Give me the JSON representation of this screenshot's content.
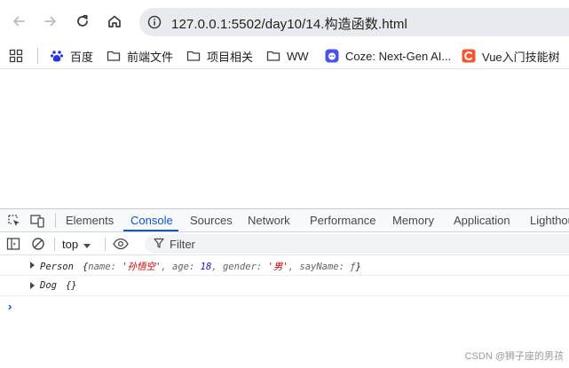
{
  "browser": {
    "url": "127.0.0.1:5502/day10/14.构造函数.html",
    "nav_icons": [
      "back-arrow-icon",
      "forward-arrow-icon",
      "reload-icon",
      "home-icon",
      "site-info-icon"
    ]
  },
  "bookmarks": {
    "items": [
      {
        "label": "百度",
        "icon": "baidu-paw-icon"
      },
      {
        "label": "前端文件",
        "icon": "folder-icon"
      },
      {
        "label": "项目相关",
        "icon": "folder-icon"
      },
      {
        "label": "WW",
        "icon": "folder-icon"
      },
      {
        "label": "Coze: Next-Gen AI...",
        "icon": "coze-icon"
      },
      {
        "label": "Vue入门技能树",
        "icon": "csdn-icon"
      }
    ]
  },
  "devtools": {
    "tabs": [
      "Elements",
      "Console",
      "Sources",
      "Network",
      "Performance",
      "Memory",
      "Application",
      "Lighthouse"
    ],
    "active_tab": "Console",
    "context": "top",
    "filter_placeholder": "Filter",
    "logs": [
      {
        "class_name": "Person",
        "open": "{",
        "props": [
          {
            "key": "name",
            "value": "'孙悟空'",
            "type": "string"
          },
          {
            "key": "age",
            "value": "18",
            "type": "number"
          },
          {
            "key": "gender",
            "value": "'男'",
            "type": "string"
          },
          {
            "key": "sayName",
            "value": "ƒ",
            "type": "function"
          }
        ],
        "close": "}"
      },
      {
        "class_name": "Dog",
        "open": "{",
        "props": [],
        "close": "}"
      }
    ],
    "prompt": "›"
  },
  "watermark": "CSDN @狮子座的男孩",
  "colors": {
    "accent": "#0b57d0",
    "string": "#c80000",
    "number": "#1a1aa6"
  }
}
